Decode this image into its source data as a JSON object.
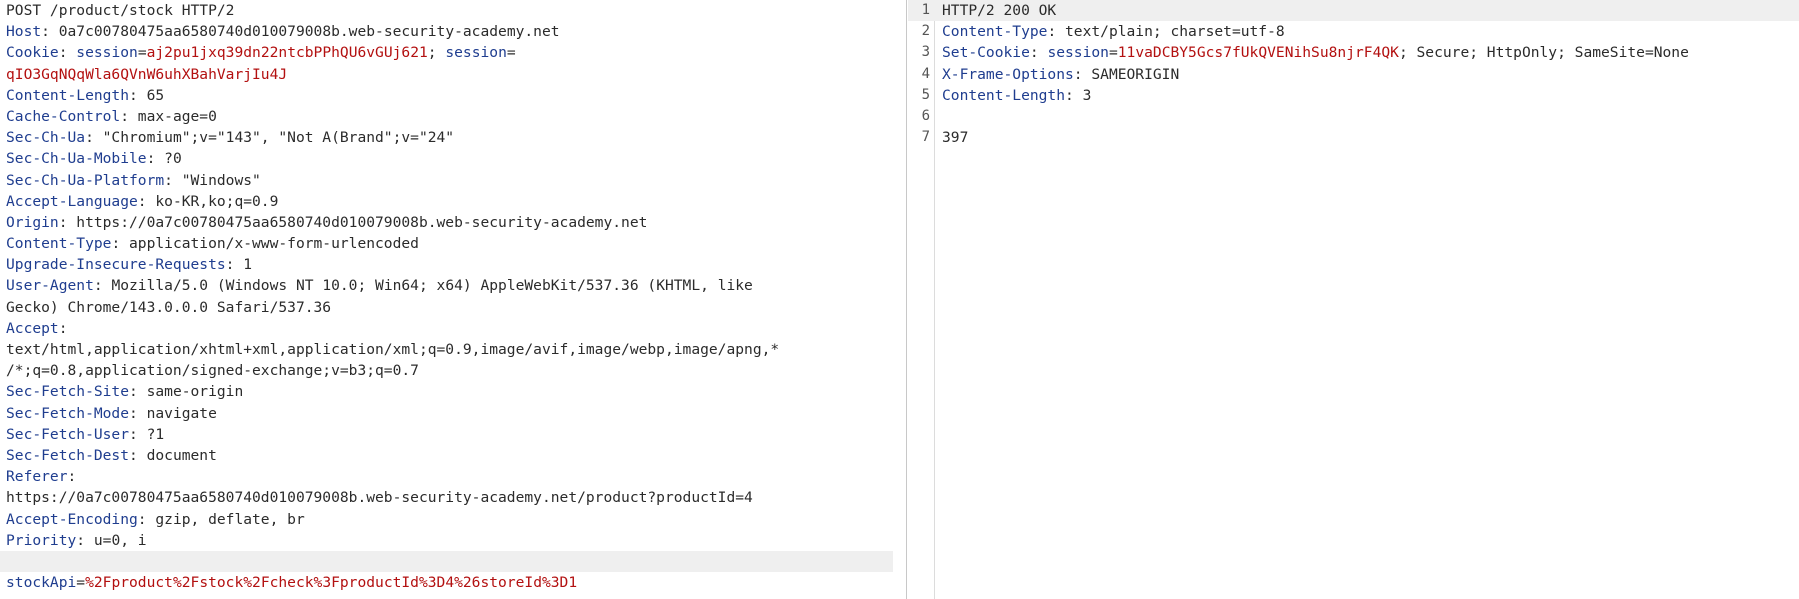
{
  "request": {
    "request_line": "POST /product/stock HTTP/2",
    "lines": [
      {
        "name": "Host",
        "value": ": 0a7c00780475aa6580740d010079008b.web-security-academy.net"
      },
      {
        "name": "Cookie",
        "cookie": true
      },
      {
        "name": "Content-Length",
        "value": ": 65"
      },
      {
        "name": "Cache-Control",
        "value": ": max-age=0"
      },
      {
        "name": "Sec-Ch-Ua",
        "value": ": \"Chromium\";v=\"143\", \"Not A(Brand\";v=\"24\""
      },
      {
        "name": "Sec-Ch-Ua-Mobile",
        "value": ": ?0"
      },
      {
        "name": "Sec-Ch-Ua-Platform",
        "value": ": \"Windows\""
      },
      {
        "name": "Accept-Language",
        "value": ": ko-KR,ko;q=0.9"
      },
      {
        "name": "Origin",
        "value": ": https://0a7c00780475aa6580740d010079008b.web-security-academy.net"
      },
      {
        "name": "Content-Type",
        "value": ": application/x-www-form-urlencoded"
      },
      {
        "name": "Upgrade-Insecure-Requests",
        "value": ": 1"
      }
    ],
    "cookie": {
      "header": "Cookie",
      "sep": ": ",
      "name1": "session",
      "eq": "=",
      "val1": "aj2pu1jxq39dn22ntcbPPhQU6vGUj621",
      "semi": "; ",
      "name2": "session",
      "eq2": "=",
      "val2": "qIO3GqNQqWla6QVnW6uhXBahVarjIu4J"
    },
    "user_agent": {
      "name": "User-Agent",
      "value1": ": Mozilla/5.0 (Windows NT 10.0; Win64; x64) AppleWebKit/537.36 (KHTML, like",
      "value2": "Gecko) Chrome/143.0.0.0 Safari/537.36"
    },
    "accept": {
      "name": "Accept",
      "colon": ":",
      "value1": "text/html,application/xhtml+xml,application/xml;q=0.9,image/avif,image/webp,image/apng,*",
      "value2": "/*;q=0.8,application/signed-exchange;v=b3;q=0.7"
    },
    "lines2": [
      {
        "name": "Sec-Fetch-Site",
        "value": ": same-origin"
      },
      {
        "name": "Sec-Fetch-Mode",
        "value": ": navigate"
      },
      {
        "name": "Sec-Fetch-User",
        "value": ": ?1"
      },
      {
        "name": "Sec-Fetch-Dest",
        "value": ": document"
      }
    ],
    "referer": {
      "name": "Referer",
      "colon": ":",
      "value": "https://0a7c00780475aa6580740d010079008b.web-security-academy.net/product?productId=4"
    },
    "lines3": [
      {
        "name": "Accept-Encoding",
        "value": ": gzip, deflate, br"
      },
      {
        "name": "Priority",
        "value": ": u=0, i"
      }
    ],
    "body": {
      "param": "stockApi",
      "eq": "=",
      "value": "%2Fproduct%2Fstock%2Fcheck%3FproductId%3D4%26storeId%3D1"
    }
  },
  "response": {
    "line_numbers": [
      "1",
      "2",
      "3",
      "4",
      "5",
      "6",
      "7"
    ],
    "status_line": "HTTP/2 200 OK",
    "content_type": {
      "name": "Content-Type",
      "value": ": text/plain; charset=utf-8"
    },
    "set_cookie": {
      "name": "Set-Cookie",
      "sep": ": ",
      "ck_name": "session",
      "eq": "=",
      "ck_val": "11vaDCBY5Gcs7fUkQVENihSu8njrF4QK",
      "attrs": "; Secure; HttpOnly; SameSite=None"
    },
    "x_frame": {
      "name": "X-Frame-Options",
      "value": ": SAMEORIGIN"
    },
    "content_length": {
      "name": "Content-Length",
      "value": ": 3"
    },
    "body": "397"
  }
}
